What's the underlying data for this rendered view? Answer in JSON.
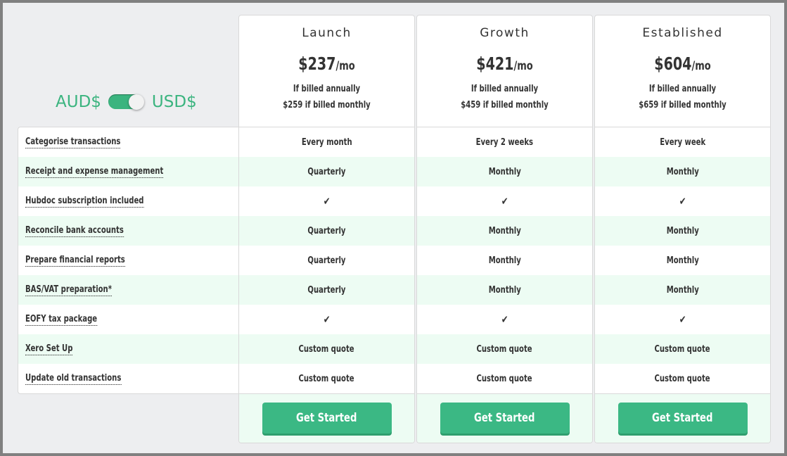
{
  "currency_toggle": {
    "left_label": "AUD$",
    "right_label": "USD$",
    "state": "on"
  },
  "features": [
    "Categorise transactions",
    "Receipt and expense management",
    "Hubdoc subscription included",
    "Reconcile bank accounts",
    "Prepare financial reports",
    "BAS/VAT preparation*",
    "EOFY tax package",
    "Xero Set Up",
    "Update old transactions"
  ],
  "plans": [
    {
      "name": "Launch",
      "price": "$237",
      "per": "/mo",
      "note1": "If billed annually",
      "note2": "$259 if billed monthly",
      "values": [
        "Every month",
        "Quarterly",
        "✔",
        "Quarterly",
        "Quarterly",
        "Quarterly",
        "✔",
        "Custom quote",
        "Custom quote"
      ],
      "button": "Get Started"
    },
    {
      "name": "Growth",
      "price": "$421",
      "per": "/mo",
      "note1": "If billed annually",
      "note2": "$459 if billed monthly",
      "values": [
        "Every 2 weeks",
        "Monthly",
        "✔",
        "Monthly",
        "Monthly",
        "Monthly",
        "✔",
        "Custom quote",
        "Custom quote"
      ],
      "button": "Get Started"
    },
    {
      "name": "Established",
      "price": "$604",
      "per": "/mo",
      "note1": "If billed annually",
      "note2": "$659 if billed monthly",
      "values": [
        "Every week",
        "Monthly",
        "✔",
        "Monthly",
        "Monthly",
        "Monthly",
        "✔",
        "Custom quote",
        "Custom quote"
      ],
      "button": "Get Started"
    }
  ],
  "colors": {
    "accent": "#3bb884",
    "row_alt": "#edfcf3",
    "background": "#edeef0"
  }
}
